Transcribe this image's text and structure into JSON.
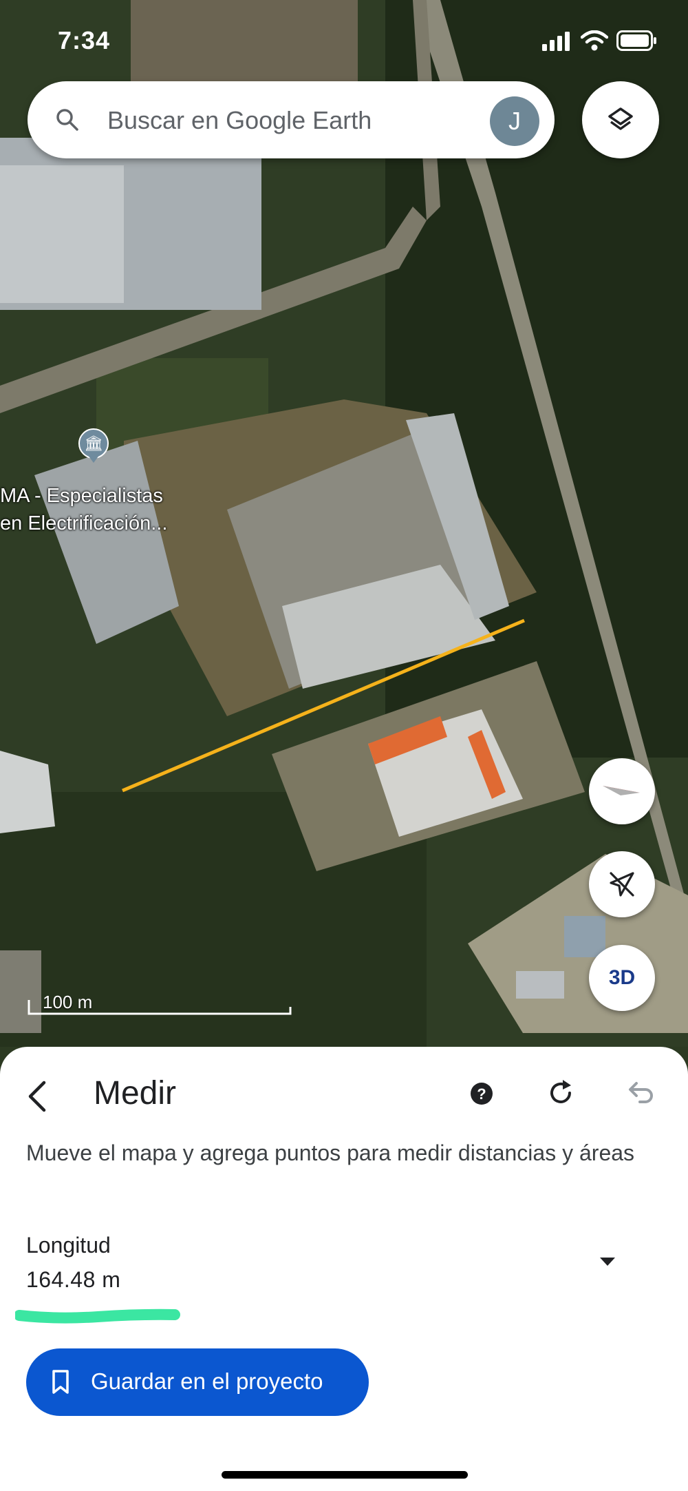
{
  "status_bar": {
    "time": "7:34"
  },
  "search": {
    "placeholder": "Buscar en Google Earth",
    "avatar_initial": "J"
  },
  "map": {
    "place_label_line1": "MA - Especialistas",
    "place_label_line2": "en Electrificación...",
    "scale_label": "100 m",
    "button_3d": "3D",
    "measure_line_color": "#f5b21b"
  },
  "measure_panel": {
    "title": "Medir",
    "description": "Mueve el mapa y agrega puntos para medir distancias y áreas",
    "metric_label": "Longitud",
    "metric_value": "164.48 m",
    "save_button": "Guardar en el proyecto"
  },
  "icons": [
    "search-icon",
    "layers-icon",
    "compass-icon",
    "location-off-icon",
    "back-arrow-icon",
    "help-icon",
    "redo-icon",
    "undo-icon",
    "dropdown-icon",
    "bookmark-icon",
    "museum-icon",
    "signal-icon",
    "wifi-icon",
    "battery-icon"
  ],
  "colors": {
    "accent": "#0b57d0",
    "highlight": "#3be6a2",
    "measure_line": "#f5b21b"
  }
}
